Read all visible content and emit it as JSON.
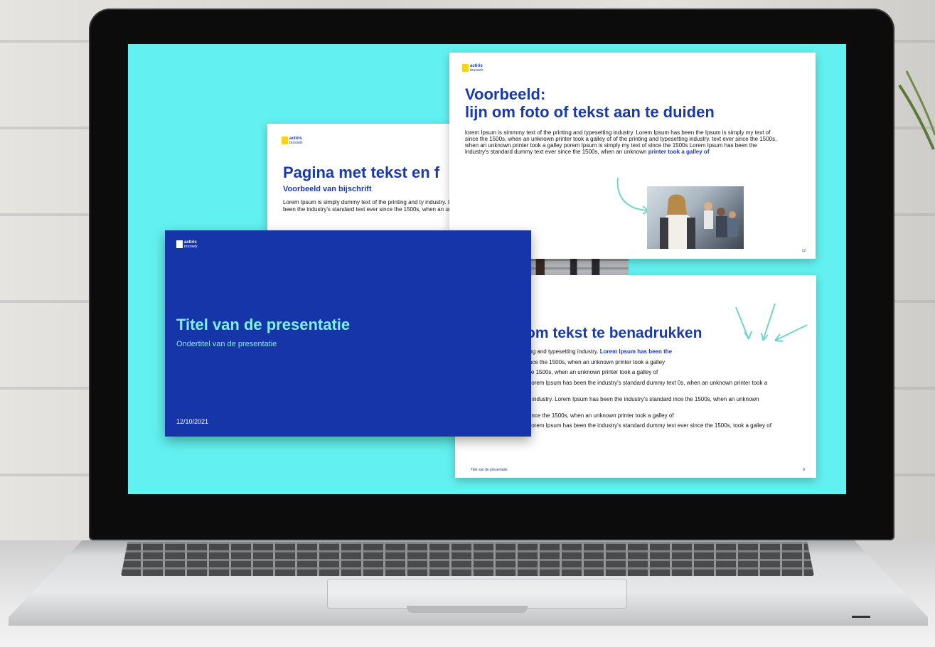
{
  "slides": {
    "title_slide": {
      "logo": {
        "name": "actiris",
        "tagline": "brussels"
      },
      "title": "Titel van de presentatie",
      "subtitle": "Ondertitel van de presentatie",
      "date": "12/10/2021"
    },
    "text_photo_slide": {
      "logo": {
        "name": "actiris",
        "tagline": "brussels"
      },
      "title": "Pagina met tekst en f",
      "caption": "Voorbeeld van bijschrift",
      "body": "Lorem Ipsum is simply dummy text of the printing and ty industry. Lorem Ipsum has been the industry's standard text ever since the 1500s, when an unknown printer too"
    },
    "line_slide": {
      "logo": {
        "name": "actiris",
        "tagline": "brussels"
      },
      "title_line1": "Voorbeeld:",
      "title_line2": "lijn om foto of tekst aan te duiden",
      "body": "lorem Ipsum is simmmy text of the printing and typesetting industry. Lorem Ipsum has been the Ipsum is simply my text of since the 1500s, when an unknown printer took a galley of of the printing and typesetting industry. text ever since the 1500s, when an unknown printer took a galley porem Ipsum is simply my text of since the 1500s Lorem Ipsum has been the industry's standard dummy text ever since the 1500s, when an unknown",
      "body_highlight": "printer took a galley of",
      "page_number": "12"
    },
    "emphasis_slide": {
      "title": "om tekst te benadrukken",
      "lines": [
        {
          "text": "mmy text of the printing and typesetting industry.",
          "highlight": "Lorem Ipsum has been the"
        },
        {
          "text": "d dummy text ever since the 1500s, when an unknown printer took a galley",
          "highlight": ""
        },
        {
          "text": "ply my text of since the 1500s, when an unknown printer took a galley of",
          "highlight": ""
        },
        {
          "text": "typesetting industry. Lorem Ipsum has been the industry's standard dummy text 0s, when an unknown printer took a galley of",
          "highlight": ""
        },
        {
          "text": "text of the typesetting industry. Lorem Ipsum has been the industry's standard ince the 1500s, when an unknown printer took a galley",
          "highlight": ""
        },
        {
          "text": "mply dummy text of since the 1500s, when an unknown printer took a galley of",
          "highlight": ""
        },
        {
          "text": "typesetting industry. Lorem Ipsum has been the industry's standard dummy text ever since the 1500s, took a galley of",
          "highlight": ""
        }
      ],
      "footer": "Titel van de presentatie",
      "page_number": "9"
    }
  },
  "colors": {
    "screen_bg": "#62f1f0",
    "brand_blue": "#1535a8",
    "accent_cyan": "#7ff0e6",
    "logo_yellow": "#f4d21f"
  }
}
